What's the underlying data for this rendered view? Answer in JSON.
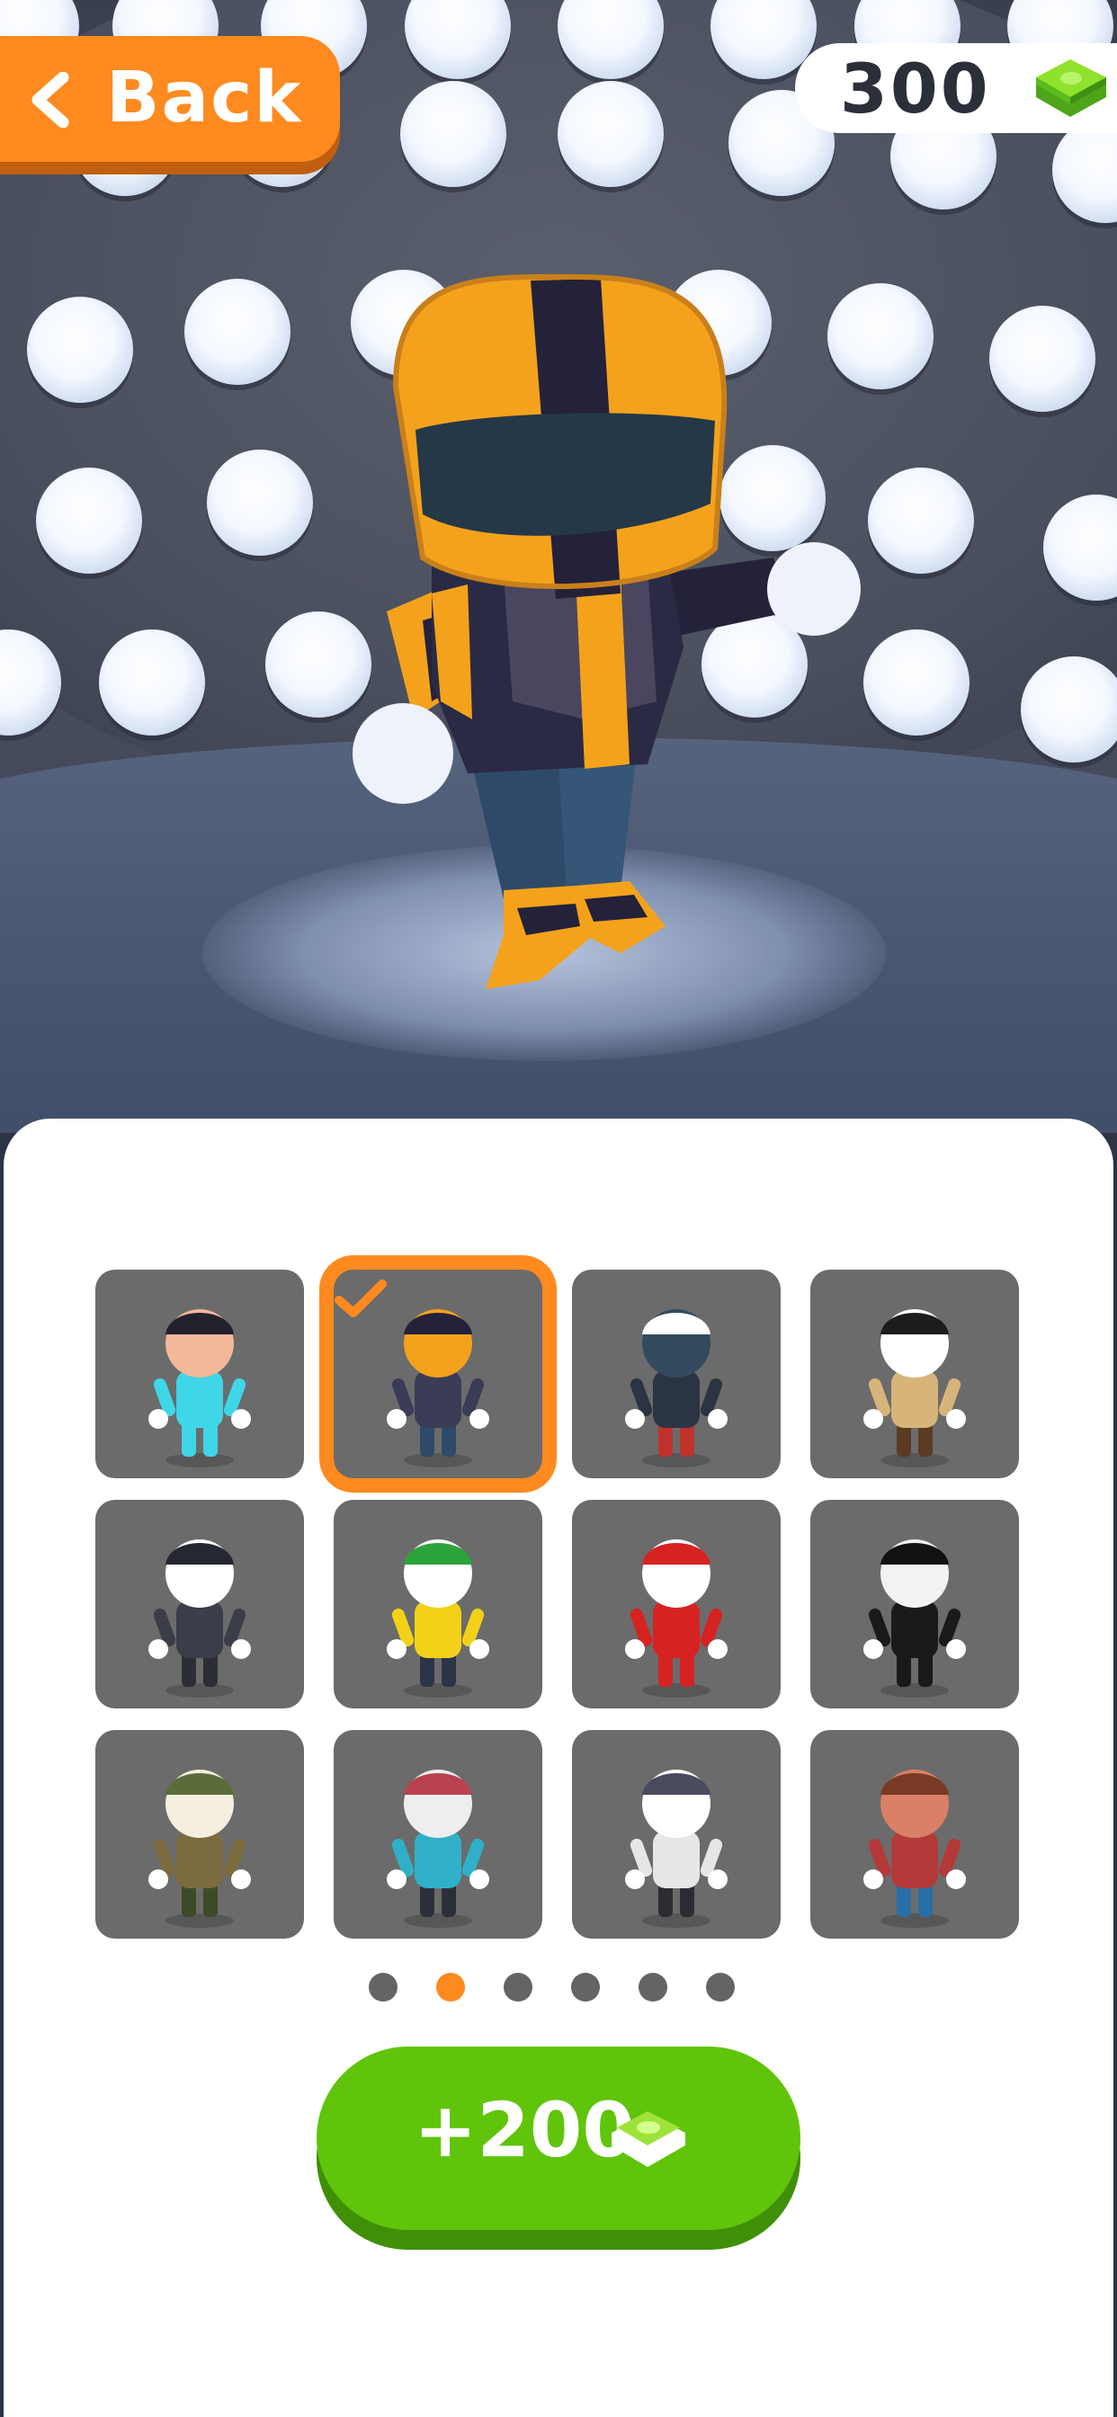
{
  "header": {
    "back_label": "Back",
    "coins": "300",
    "coin_icon": "cash-stack-icon"
  },
  "stage": {
    "character": "motorcycle-helmet-racer"
  },
  "skins": [
    {
      "name": "genie",
      "selected": false
    },
    {
      "name": "racer",
      "selected": true
    },
    {
      "name": "ninja",
      "selected": false
    },
    {
      "name": "pirate",
      "selected": false
    },
    {
      "name": "police-officer",
      "selected": false
    },
    {
      "name": "punk",
      "selected": false
    },
    {
      "name": "santa",
      "selected": false
    },
    {
      "name": "skeleton",
      "selected": false
    },
    {
      "name": "soldier",
      "selected": false
    },
    {
      "name": "zombie",
      "selected": false
    },
    {
      "name": "burglar",
      "selected": false
    },
    {
      "name": "girl",
      "selected": false
    }
  ],
  "pagination": {
    "count": 6,
    "active_index": 1
  },
  "reward_button": {
    "label": "+200",
    "icon": "cash-stack-icon"
  },
  "colors": {
    "accent": "#ff8a1f",
    "tile": "#6b6b6b",
    "reward": "#5fc40a",
    "cash": "#7dcf1e"
  }
}
